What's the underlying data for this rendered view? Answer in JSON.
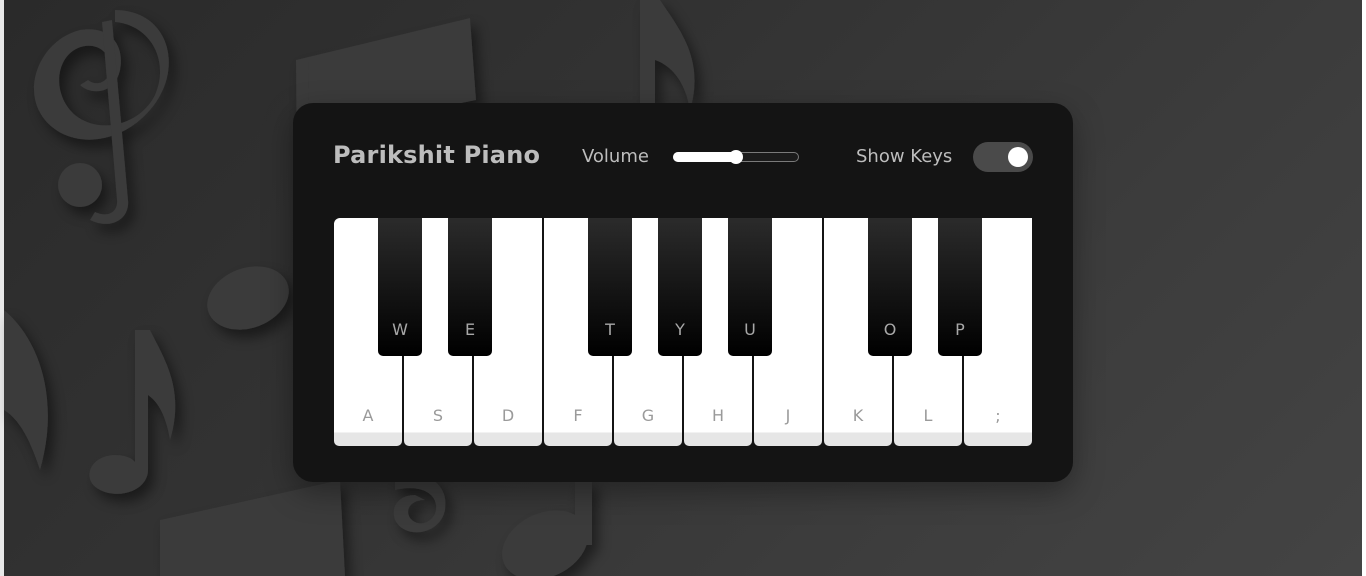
{
  "app": {
    "title": "Parikshit Piano"
  },
  "controls": {
    "volume_label": "Volume",
    "volume_value": 0.5,
    "show_keys_label": "Show Keys",
    "show_keys_on": true
  },
  "piano": {
    "white_keys": [
      {
        "label": "A"
      },
      {
        "label": "S"
      },
      {
        "label": "D"
      },
      {
        "label": "F"
      },
      {
        "label": "G"
      },
      {
        "label": "H"
      },
      {
        "label": "J"
      },
      {
        "label": "K"
      },
      {
        "label": "L"
      },
      {
        "label": ";"
      }
    ],
    "black_keys": [
      {
        "label": "W"
      },
      {
        "label": "E"
      },
      {
        "label": "T"
      },
      {
        "label": "Y"
      },
      {
        "label": "U"
      },
      {
        "label": "O"
      },
      {
        "label": "P"
      }
    ]
  },
  "colors": {
    "panel": "#141414",
    "label_gray": "#bdbdbd",
    "white_key": "#ffffff",
    "black_key": "#000000"
  }
}
